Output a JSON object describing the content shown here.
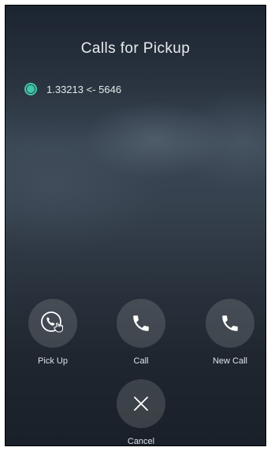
{
  "screen": {
    "title": "Calls for Pickup"
  },
  "calls": [
    {
      "label": "1.33213 <- 5646",
      "selected": true
    }
  ],
  "actions": {
    "pick_up": {
      "label": "Pick Up",
      "icon": "pickup-phone-icon"
    },
    "call": {
      "label": "Call",
      "icon": "phone-icon"
    },
    "new_call": {
      "label": "New Call",
      "icon": "phone-icon"
    },
    "cancel": {
      "label": "Cancel",
      "icon": "close-icon"
    }
  },
  "colors": {
    "accent": "#3fc7a8",
    "button_bg": "rgba(255,255,255,0.14)",
    "text": "#e8ecef"
  }
}
